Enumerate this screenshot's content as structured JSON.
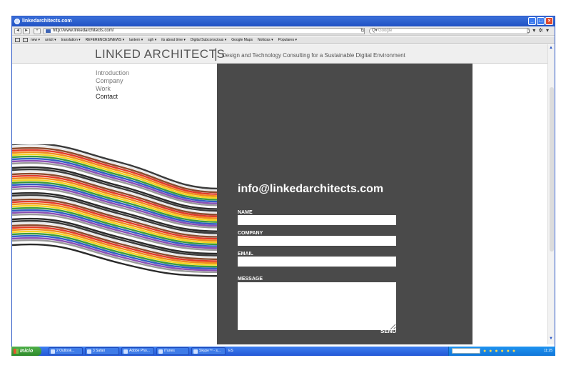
{
  "window": {
    "title": "linkedarchitects.com",
    "controls": [
      "minimize",
      "maximize",
      "close"
    ]
  },
  "toolbar": {
    "back": "◄",
    "forward": "►",
    "add": "+",
    "url": "http://www.linkedarchitects.com/",
    "reload": "↻",
    "search_placeholder": "Google",
    "page_icon": "page-icon",
    "settings_icon": "gear-icon"
  },
  "bookmarks": [
    "new ▾",
    "unicit ▾",
    "translation ▾",
    "REFERENCES/NEWS ▾",
    "lantern ▾",
    "sgh ▾",
    "its about time ▾",
    "Digital Subconscious ▾",
    "Google Maps",
    "Noticias ▾",
    "Populares ▾"
  ],
  "site": {
    "title": "LINKED ARCHITECTS",
    "separator": "|",
    "tagline": "Design and Technology Consulting for a Sustainable Digital Environment",
    "nav": [
      {
        "label": "Introduction",
        "active": false
      },
      {
        "label": "Company",
        "active": false
      },
      {
        "label": "Work",
        "active": false
      },
      {
        "label": "Contact",
        "active": true
      }
    ],
    "contact": {
      "email": "info@linkedarchitects.com",
      "fields": {
        "name": "NAME",
        "company": "COMPANY",
        "email": "EMAIL",
        "message": "MESSAGE"
      },
      "send": "SEND"
    },
    "panel_color": "#4a4a4a"
  },
  "cables": {
    "colors": [
      "#3a3a3a",
      "#e8e8e8",
      "#8b4a2b",
      "#e23b2a",
      "#f08a1c",
      "#f4d21f",
      "#3a9b3a",
      "#2f5fc4",
      "#8a4fb5",
      "#9a9a9a",
      "#ffffff",
      "#2a2a2a"
    ]
  },
  "taskbar": {
    "start": "Inicio",
    "tasks": [
      "2 Outlook...",
      "3 Safari",
      "Adobe Pho...",
      "iTunes",
      "Skype™ - s..."
    ],
    "language": "ES",
    "clock": "11:25"
  }
}
